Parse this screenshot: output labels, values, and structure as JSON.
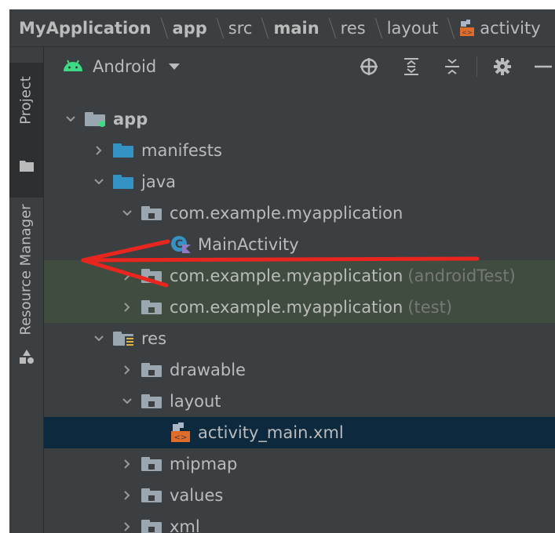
{
  "breadcrumb": {
    "items": [
      {
        "label": "MyApplication",
        "bold": true
      },
      {
        "label": "app",
        "bold": true
      },
      {
        "label": "src",
        "bold": false
      },
      {
        "label": "main",
        "bold": true
      },
      {
        "label": "res",
        "bold": false
      },
      {
        "label": "layout",
        "bold": false
      },
      {
        "label": "activity",
        "bold": false
      }
    ]
  },
  "side_strip": {
    "project_label": "Project",
    "resource_manager_label": "Resource Manager"
  },
  "toolbar": {
    "view_mode": "Android",
    "icons": [
      "locate-icon",
      "expand-all-icon",
      "collapse-all-icon",
      "gear-icon",
      "minimize-icon"
    ]
  },
  "tree": {
    "rows": [
      {
        "label": "app",
        "bold": true,
        "expanded": true,
        "icon": "module-folder-icon"
      },
      {
        "label": "manifests",
        "expanded": false,
        "icon": "folder-icon"
      },
      {
        "label": "java",
        "expanded": true,
        "icon": "folder-icon"
      },
      {
        "label": "com.example.myapplication",
        "expanded": true,
        "icon": "package-icon"
      },
      {
        "label": "MainActivity",
        "icon": "kotlin-class-icon"
      },
      {
        "label": "com.example.myapplication",
        "hint": "(androidTest)",
        "expanded": false,
        "icon": "package-icon",
        "highlight": true
      },
      {
        "label": "com.example.myapplication",
        "hint": "(test)",
        "expanded": false,
        "icon": "package-icon",
        "highlight": true
      },
      {
        "label": "res",
        "expanded": true,
        "icon": "resource-folder-icon"
      },
      {
        "label": "drawable",
        "expanded": false,
        "icon": "package-icon"
      },
      {
        "label": "layout",
        "expanded": true,
        "icon": "package-icon"
      },
      {
        "label": "activity_main.xml",
        "icon": "layout-xml-icon",
        "selected": true
      },
      {
        "label": "mipmap",
        "expanded": false,
        "icon": "package-icon"
      },
      {
        "label": "values",
        "expanded": false,
        "icon": "package-icon"
      },
      {
        "label": "xml",
        "expanded": false,
        "icon": "package-icon"
      }
    ]
  },
  "colors": {
    "background": "#3c3f41",
    "text": "#bbbbbb",
    "hint_text": "#787878",
    "selection": "#0d293e",
    "highlight": "#3f4c3f",
    "folder_blue": "#3592c4",
    "android_green": "#3ddc84",
    "annotation_arrow": "#e8251f"
  }
}
